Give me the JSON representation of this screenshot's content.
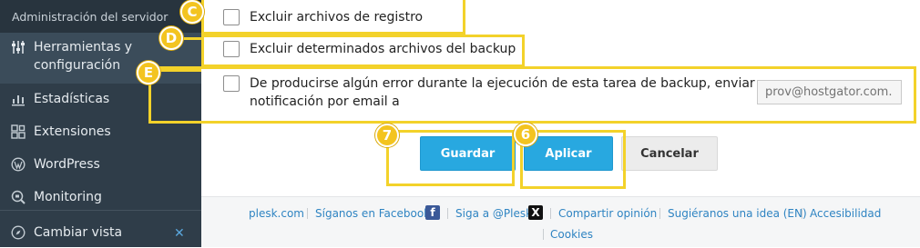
{
  "sidebar": {
    "header": "Administración del servidor",
    "items": [
      {
        "label_line1": "Herramientas y",
        "label_line2": "configuración",
        "icon": "sliders-icon",
        "active": true
      },
      {
        "label": "Estadísticas",
        "icon": "bar-chart-icon"
      },
      {
        "label": "Extensiones",
        "icon": "extensions-icon"
      },
      {
        "label": "WordPress",
        "icon": "wordpress-icon"
      },
      {
        "label": "Monitoring",
        "icon": "monitoring-icon"
      }
    ],
    "switch_view": {
      "label": "Cambiar vista",
      "icon": "compass-icon",
      "close_glyph": "✕"
    }
  },
  "form": {
    "exclude_logs": {
      "label": "Excluir archivos de registro",
      "checked": false
    },
    "exclude_files": {
      "label": "Excluir determinados archivos del backup",
      "checked": false
    },
    "notify_error": {
      "line1": "De producirse algún error durante la ejecución de esta tarea de backup, enviar una",
      "line2": "notificación por email a",
      "checked": false,
      "email_value": "prov@hostgator.com."
    }
  },
  "buttons": {
    "save": "Guardar",
    "apply": "Aplicar",
    "cancel": "Cancelar"
  },
  "annotations": {
    "c": "C",
    "d": "D",
    "e": "E",
    "seven": "7",
    "six": "6"
  },
  "annotation_color": "#f3d22a",
  "footer": {
    "links": [
      "plesk.com",
      "Síganos en Facebook",
      "Siga a @Plesk",
      "Compartir opinión",
      "Sugiéranos una idea (EN)",
      "Accesibilidad",
      "Cookies"
    ],
    "fb_glyph": "f",
    "x_glyph": "X"
  },
  "colors": {
    "sidebar_bg": "#2f3d49",
    "primary": "#28a8e0",
    "link": "#2f84c2"
  }
}
